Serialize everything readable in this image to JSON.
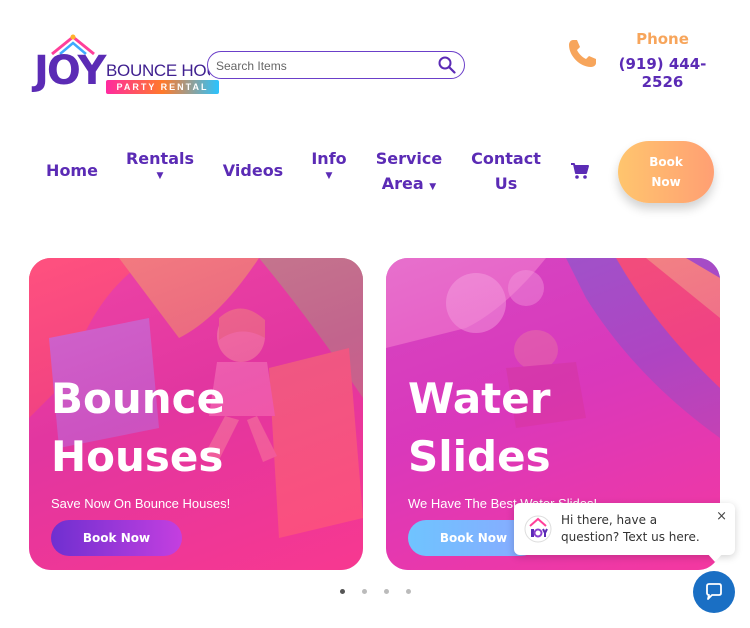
{
  "logo": {
    "brand": "JOY",
    "name": "BOUNCE HOUSES",
    "tagline": "PARTY RENTAL"
  },
  "search": {
    "placeholder": "Search Items"
  },
  "contact": {
    "label": "Phone",
    "number": "(919) 444-2526"
  },
  "nav": {
    "home": "Home",
    "rentals": "Rentals",
    "videos": "Videos",
    "info": "Info",
    "service_line1": "Service",
    "service_line2": "Area",
    "contact_line1": "Contact",
    "contact_line2": "Us",
    "book_line1": "Book",
    "book_line2": "Now"
  },
  "cards": [
    {
      "title_line1": "Bounce",
      "title_line2": "Houses",
      "subtitle": "Save Now On Bounce Houses!",
      "button": "Book Now"
    },
    {
      "title_line1": "Water",
      "title_line2": "Slides",
      "subtitle": "We Have The Best Water Slides!",
      "button": "Book Now"
    }
  ],
  "carousel": {
    "pages": 4,
    "active": 1
  },
  "chat": {
    "message": "Hi there, have a question? Text us here.",
    "close": "×"
  },
  "colors": {
    "brand_purple": "#5b2bb5",
    "accent_orange": "#f7a55b",
    "chat_blue": "#1a6fc4"
  }
}
